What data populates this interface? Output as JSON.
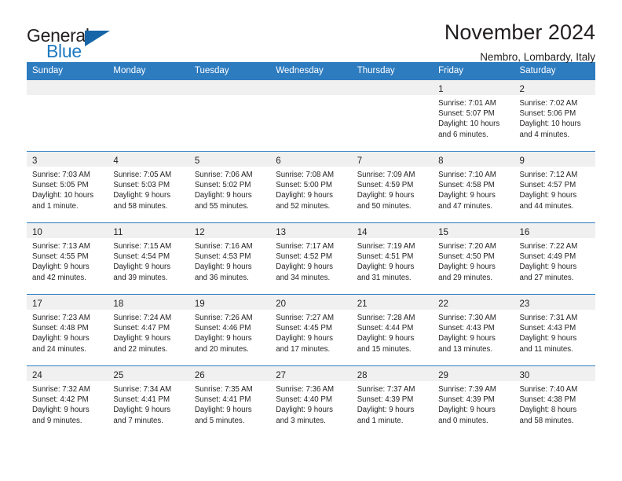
{
  "brand": {
    "name_part1": "General",
    "name_part2": "Blue",
    "triangle_icon": "triangle-logo-icon",
    "accent_color": "#1f7ac0"
  },
  "header": {
    "title": "November 2024",
    "subtitle": "Nembro, Lombardy, Italy"
  },
  "theme": {
    "header_blue": "#2e7cc0",
    "day_band_gray": "#f0f0f0",
    "text_color": "#231f20"
  },
  "weekdays": [
    "Sunday",
    "Monday",
    "Tuesday",
    "Wednesday",
    "Thursday",
    "Friday",
    "Saturday"
  ],
  "labels": {
    "sunrise": "Sunrise:",
    "sunset": "Sunset:",
    "daylight": "Daylight:"
  },
  "weeks": [
    [
      {
        "empty": true
      },
      {
        "empty": true
      },
      {
        "empty": true
      },
      {
        "empty": true
      },
      {
        "empty": true
      },
      {
        "day": "1",
        "sunrise": "Sunrise: 7:01 AM",
        "sunset": "Sunset: 5:07 PM",
        "daylight1": "Daylight: 10 hours",
        "daylight2": "and 6 minutes."
      },
      {
        "day": "2",
        "sunrise": "Sunrise: 7:02 AM",
        "sunset": "Sunset: 5:06 PM",
        "daylight1": "Daylight: 10 hours",
        "daylight2": "and 4 minutes."
      }
    ],
    [
      {
        "day": "3",
        "sunrise": "Sunrise: 7:03 AM",
        "sunset": "Sunset: 5:05 PM",
        "daylight1": "Daylight: 10 hours",
        "daylight2": "and 1 minute."
      },
      {
        "day": "4",
        "sunrise": "Sunrise: 7:05 AM",
        "sunset": "Sunset: 5:03 PM",
        "daylight1": "Daylight: 9 hours",
        "daylight2": "and 58 minutes."
      },
      {
        "day": "5",
        "sunrise": "Sunrise: 7:06 AM",
        "sunset": "Sunset: 5:02 PM",
        "daylight1": "Daylight: 9 hours",
        "daylight2": "and 55 minutes."
      },
      {
        "day": "6",
        "sunrise": "Sunrise: 7:08 AM",
        "sunset": "Sunset: 5:00 PM",
        "daylight1": "Daylight: 9 hours",
        "daylight2": "and 52 minutes."
      },
      {
        "day": "7",
        "sunrise": "Sunrise: 7:09 AM",
        "sunset": "Sunset: 4:59 PM",
        "daylight1": "Daylight: 9 hours",
        "daylight2": "and 50 minutes."
      },
      {
        "day": "8",
        "sunrise": "Sunrise: 7:10 AM",
        "sunset": "Sunset: 4:58 PM",
        "daylight1": "Daylight: 9 hours",
        "daylight2": "and 47 minutes."
      },
      {
        "day": "9",
        "sunrise": "Sunrise: 7:12 AM",
        "sunset": "Sunset: 4:57 PM",
        "daylight1": "Daylight: 9 hours",
        "daylight2": "and 44 minutes."
      }
    ],
    [
      {
        "day": "10",
        "sunrise": "Sunrise: 7:13 AM",
        "sunset": "Sunset: 4:55 PM",
        "daylight1": "Daylight: 9 hours",
        "daylight2": "and 42 minutes."
      },
      {
        "day": "11",
        "sunrise": "Sunrise: 7:15 AM",
        "sunset": "Sunset: 4:54 PM",
        "daylight1": "Daylight: 9 hours",
        "daylight2": "and 39 minutes."
      },
      {
        "day": "12",
        "sunrise": "Sunrise: 7:16 AM",
        "sunset": "Sunset: 4:53 PM",
        "daylight1": "Daylight: 9 hours",
        "daylight2": "and 36 minutes."
      },
      {
        "day": "13",
        "sunrise": "Sunrise: 7:17 AM",
        "sunset": "Sunset: 4:52 PM",
        "daylight1": "Daylight: 9 hours",
        "daylight2": "and 34 minutes."
      },
      {
        "day": "14",
        "sunrise": "Sunrise: 7:19 AM",
        "sunset": "Sunset: 4:51 PM",
        "daylight1": "Daylight: 9 hours",
        "daylight2": "and 31 minutes."
      },
      {
        "day": "15",
        "sunrise": "Sunrise: 7:20 AM",
        "sunset": "Sunset: 4:50 PM",
        "daylight1": "Daylight: 9 hours",
        "daylight2": "and 29 minutes."
      },
      {
        "day": "16",
        "sunrise": "Sunrise: 7:22 AM",
        "sunset": "Sunset: 4:49 PM",
        "daylight1": "Daylight: 9 hours",
        "daylight2": "and 27 minutes."
      }
    ],
    [
      {
        "day": "17",
        "sunrise": "Sunrise: 7:23 AM",
        "sunset": "Sunset: 4:48 PM",
        "daylight1": "Daylight: 9 hours",
        "daylight2": "and 24 minutes."
      },
      {
        "day": "18",
        "sunrise": "Sunrise: 7:24 AM",
        "sunset": "Sunset: 4:47 PM",
        "daylight1": "Daylight: 9 hours",
        "daylight2": "and 22 minutes."
      },
      {
        "day": "19",
        "sunrise": "Sunrise: 7:26 AM",
        "sunset": "Sunset: 4:46 PM",
        "daylight1": "Daylight: 9 hours",
        "daylight2": "and 20 minutes."
      },
      {
        "day": "20",
        "sunrise": "Sunrise: 7:27 AM",
        "sunset": "Sunset: 4:45 PM",
        "daylight1": "Daylight: 9 hours",
        "daylight2": "and 17 minutes."
      },
      {
        "day": "21",
        "sunrise": "Sunrise: 7:28 AM",
        "sunset": "Sunset: 4:44 PM",
        "daylight1": "Daylight: 9 hours",
        "daylight2": "and 15 minutes."
      },
      {
        "day": "22",
        "sunrise": "Sunrise: 7:30 AM",
        "sunset": "Sunset: 4:43 PM",
        "daylight1": "Daylight: 9 hours",
        "daylight2": "and 13 minutes."
      },
      {
        "day": "23",
        "sunrise": "Sunrise: 7:31 AM",
        "sunset": "Sunset: 4:43 PM",
        "daylight1": "Daylight: 9 hours",
        "daylight2": "and 11 minutes."
      }
    ],
    [
      {
        "day": "24",
        "sunrise": "Sunrise: 7:32 AM",
        "sunset": "Sunset: 4:42 PM",
        "daylight1": "Daylight: 9 hours",
        "daylight2": "and 9 minutes."
      },
      {
        "day": "25",
        "sunrise": "Sunrise: 7:34 AM",
        "sunset": "Sunset: 4:41 PM",
        "daylight1": "Daylight: 9 hours",
        "daylight2": "and 7 minutes."
      },
      {
        "day": "26",
        "sunrise": "Sunrise: 7:35 AM",
        "sunset": "Sunset: 4:41 PM",
        "daylight1": "Daylight: 9 hours",
        "daylight2": "and 5 minutes."
      },
      {
        "day": "27",
        "sunrise": "Sunrise: 7:36 AM",
        "sunset": "Sunset: 4:40 PM",
        "daylight1": "Daylight: 9 hours",
        "daylight2": "and 3 minutes."
      },
      {
        "day": "28",
        "sunrise": "Sunrise: 7:37 AM",
        "sunset": "Sunset: 4:39 PM",
        "daylight1": "Daylight: 9 hours",
        "daylight2": "and 1 minute."
      },
      {
        "day": "29",
        "sunrise": "Sunrise: 7:39 AM",
        "sunset": "Sunset: 4:39 PM",
        "daylight1": "Daylight: 9 hours",
        "daylight2": "and 0 minutes."
      },
      {
        "day": "30",
        "sunrise": "Sunrise: 7:40 AM",
        "sunset": "Sunset: 4:38 PM",
        "daylight1": "Daylight: 8 hours",
        "daylight2": "and 58 minutes."
      }
    ]
  ]
}
